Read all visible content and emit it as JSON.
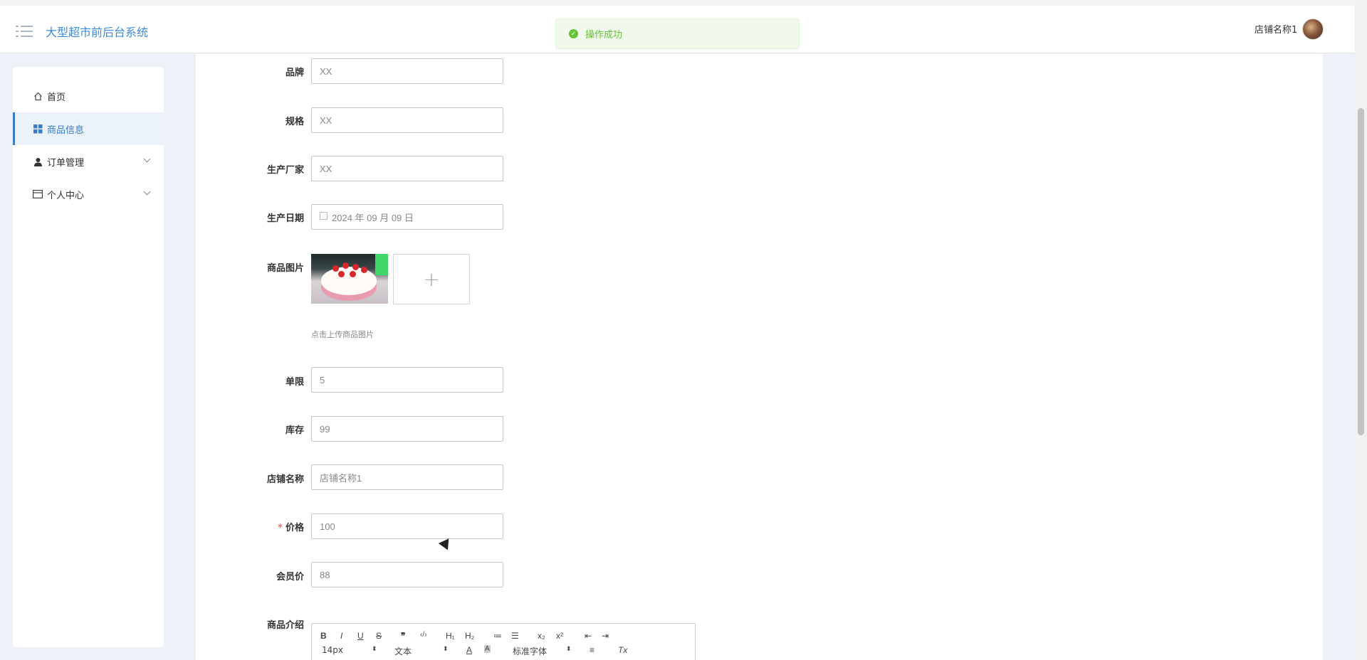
{
  "header": {
    "app_title": "大型超市前后台系统",
    "toast": "操作成功",
    "shop_name": "店铺名称1"
  },
  "sidebar": {
    "items": [
      {
        "label": "首页",
        "icon": "home-icon"
      },
      {
        "label": "商品信息",
        "icon": "grid-icon",
        "active": true
      },
      {
        "label": "订单管理",
        "icon": "user-icon",
        "expandable": true
      },
      {
        "label": "个人中心",
        "icon": "card-icon",
        "expandable": true
      }
    ]
  },
  "form": {
    "brand": {
      "label": "品牌",
      "value": "XX"
    },
    "spec": {
      "label": "规格",
      "value": "XX"
    },
    "manufacturer": {
      "label": "生产厂家",
      "value": "XX"
    },
    "production_date": {
      "label": "生产日期",
      "value": "2024 年 09 月 09 日"
    },
    "image": {
      "label": "商品图片",
      "tip": "点击上传商品图片"
    },
    "limit": {
      "label": "单限",
      "value": "5"
    },
    "stock": {
      "label": "库存",
      "value": "99"
    },
    "store_name": {
      "label": "店铺名称",
      "value": "店铺名称1"
    },
    "price": {
      "label": "价格",
      "value": "100",
      "required": "*"
    },
    "member_price": {
      "label": "会员价",
      "value": "88"
    },
    "description": {
      "label": "商品介绍"
    }
  },
  "editor": {
    "toolbar_row1": [
      "B",
      "I",
      "U",
      "S",
      "❞",
      "‹/›",
      "H₁",
      "H₂",
      "≔",
      "☰",
      "x₂",
      "x²",
      "⇤",
      "⇥"
    ],
    "font_size": "14px",
    "block_type": "文本",
    "font_family": "标准字体",
    "text_color_icon": "A",
    "bg_color_icon": "A",
    "align_icon": "≡",
    "clear_format_icon": "Tx"
  }
}
